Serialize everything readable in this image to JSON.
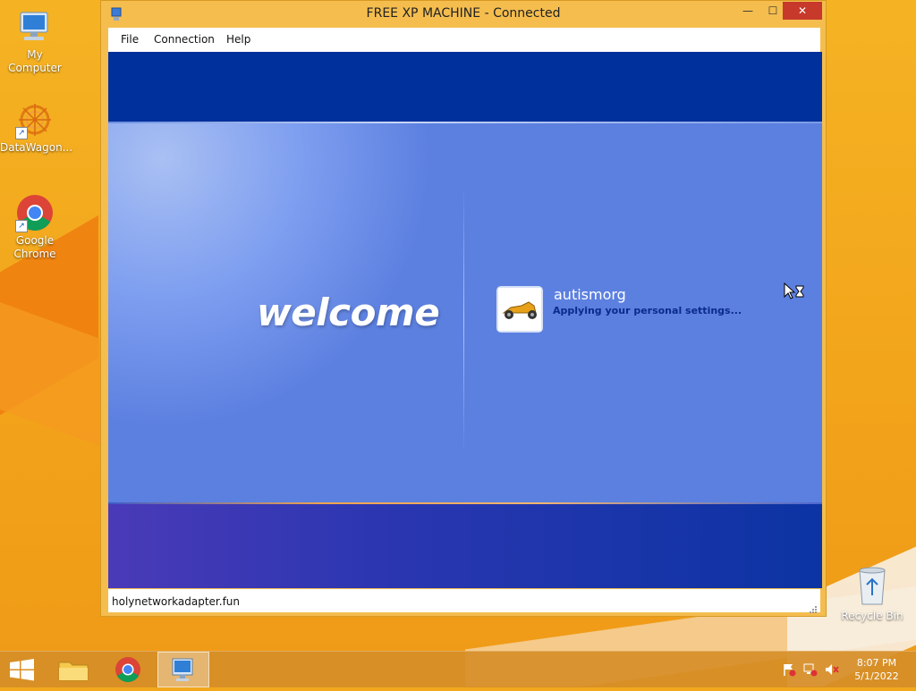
{
  "desktop": {
    "icons": [
      {
        "label": "My Computer"
      },
      {
        "label": "DataWagon..."
      },
      {
        "label": "Google Chrome"
      }
    ],
    "recycle_bin": {
      "label": "Recycle Bin"
    }
  },
  "window": {
    "title": "FREE XP MACHINE - Connected",
    "controls": {
      "minimize": "—",
      "maximize": "☐",
      "close": "✕"
    },
    "menu": [
      "File",
      "Connection",
      "Help"
    ],
    "status_text": "holynetworkadapter.fun"
  },
  "xp_session": {
    "welcome_text": "welcome",
    "user_name": "autismorg",
    "status": "Applying your personal settings..."
  },
  "taskbar": {
    "clock_time": "8:07 PM",
    "clock_date": "5/1/2022"
  },
  "colors": {
    "desktop": "#f2a81c",
    "xp_top": "#00309c",
    "xp_mid": "#5b80e0",
    "close_button": "#c7392b"
  }
}
